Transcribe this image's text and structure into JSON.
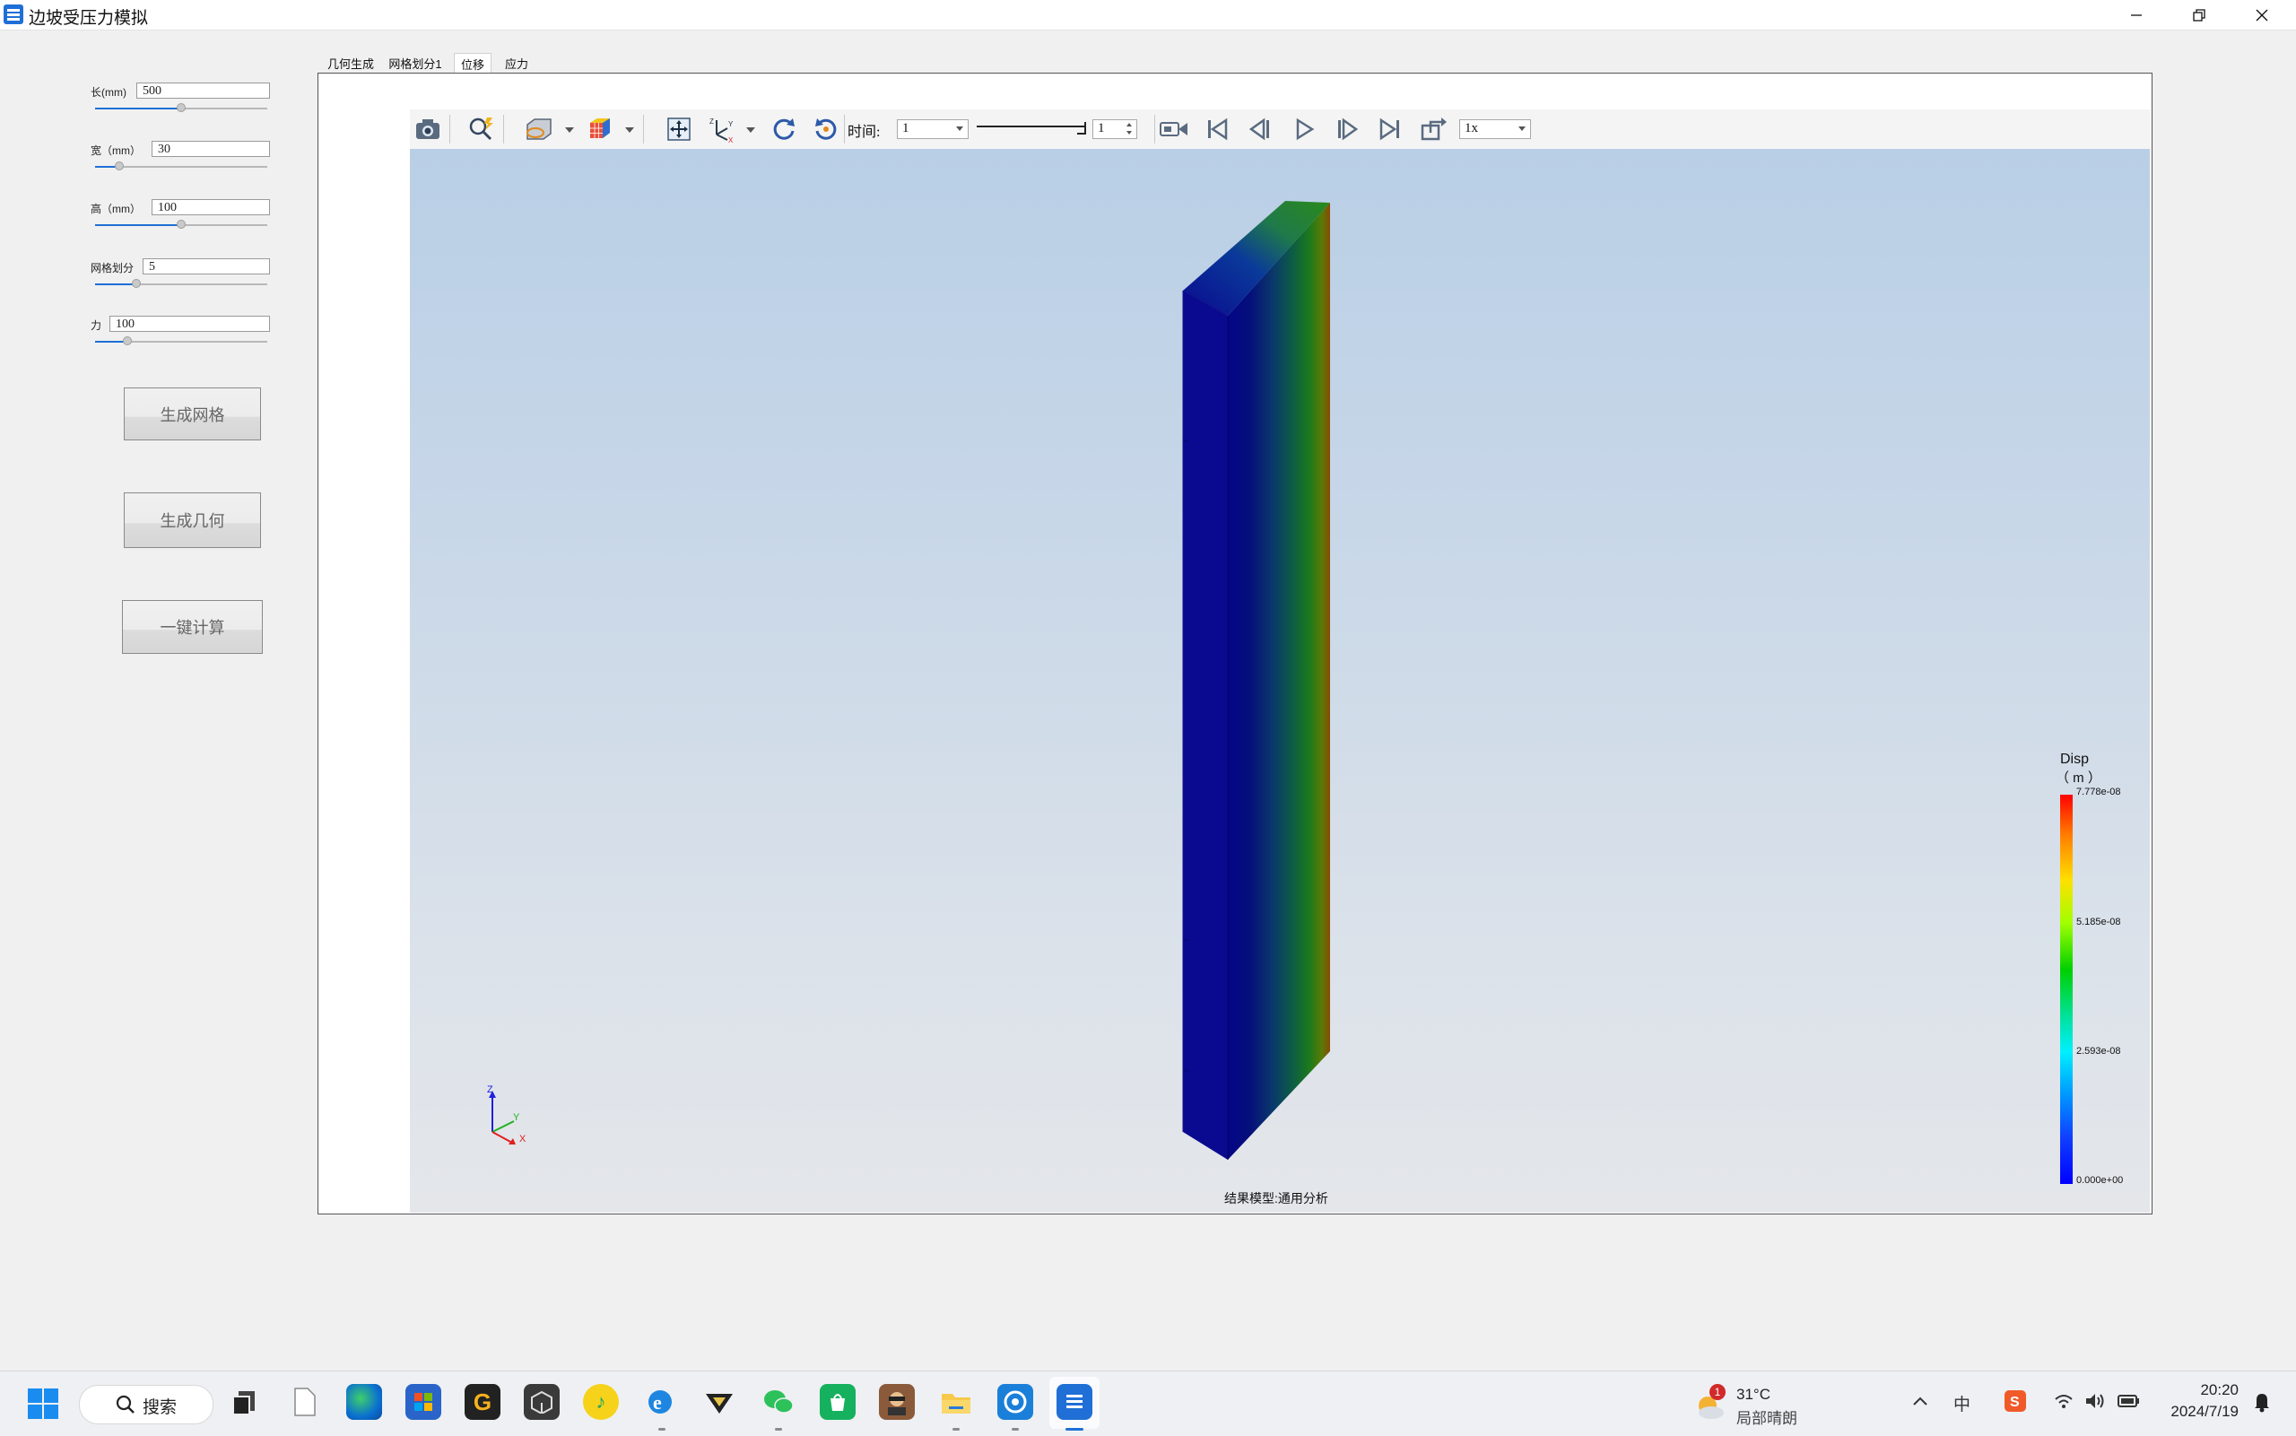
{
  "window": {
    "title": "边坡受压力模拟",
    "controls": [
      "minimize-icon",
      "restore-icon",
      "close-icon"
    ]
  },
  "params": [
    {
      "label": "长(mm)",
      "value": "500",
      "slider": 0.5
    },
    {
      "label": "宽（mm）",
      "value": "30",
      "slider": 0.14
    },
    {
      "label": "高（mm）",
      "value": "100",
      "slider": 0.5
    },
    {
      "label": "网格划分",
      "value": "5",
      "slider": 0.24
    },
    {
      "label": "力",
      "value": "100",
      "slider": 0.19
    }
  ],
  "buttons": {
    "gen_mesh": "生成网格",
    "gen_geo": "生成几何",
    "compute": "一键计算"
  },
  "tabs": [
    "几何生成",
    "网格划分1",
    "位移",
    "应力"
  ],
  "active_tab": 2,
  "toolbar": {
    "time_label": "时间:",
    "time_value": "1",
    "frame_value": "1",
    "speed_value": "1x",
    "icons": [
      "camera-icon",
      "zoom-icon",
      "display-mode-icon",
      "mesh-cube-icon",
      "fit-view-icon",
      "axes-icon",
      "rotate-cw-icon",
      "rotate-ccw-icon",
      "record-icon",
      "first-frame-icon",
      "prev-frame-icon",
      "play-icon",
      "next-frame-icon",
      "last-frame-icon",
      "export-icon"
    ]
  },
  "viewport": {
    "footer": "结果模型:通用分析",
    "axes": {
      "z": "Z",
      "y": "Y",
      "x": "X"
    }
  },
  "legend": {
    "title": "Disp",
    "unit": "（ m ）",
    "ticks": [
      "7.778e-08",
      "5.185e-08",
      "2.593e-08",
      "0.000e+00"
    ]
  },
  "taskbar": {
    "search": "搜索",
    "weather_temp": "31°C",
    "weather_desc": "局部晴朗",
    "weather_badge": "1",
    "ime": "中",
    "time": "20:20",
    "date": "2024/7/19",
    "apps": [
      "start-icon",
      "search-icon",
      "taskview-icon",
      "file-icon",
      "edge-icon",
      "store-icon",
      "g-app-icon",
      "cube-app-icon",
      "qqmusic-icon",
      "ie-icon",
      "vpn-icon",
      "wechat-icon",
      "shopping-icon",
      "avatar-app-icon",
      "explorer-icon",
      "browser2-icon",
      "active-app-icon"
    ]
  },
  "colors": {
    "accent": "#1f6fd6",
    "blue_face": "#0a0a8f",
    "legend_top": "#ff0000",
    "legend_bottom": "#0000ff"
  }
}
